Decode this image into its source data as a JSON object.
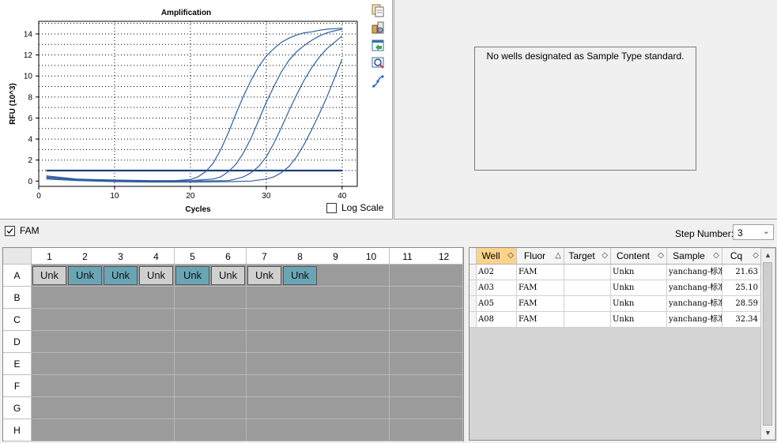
{
  "toolbar": {
    "icons": [
      "copy-icon",
      "chart-settings-icon",
      "export-icon",
      "zoom-icon",
      "curve-icon"
    ]
  },
  "chart_data": {
    "type": "line",
    "title": "Amplification",
    "xlabel": "Cycles",
    "ylabel": "RFU (10^3)",
    "xlim": [
      0,
      42
    ],
    "ylim": [
      -0.5,
      15.2
    ],
    "xticks": [
      0,
      10,
      20,
      30,
      40
    ],
    "yticks": [
      0,
      2,
      4,
      6,
      8,
      10,
      12,
      14
    ],
    "grid": true,
    "threshold": 1.0,
    "line_color": "#2f5fa0",
    "threshold_color": "#1f3f78",
    "series": [
      {
        "well": "A02",
        "cq": 21.63,
        "values": [
          [
            1,
            0.5
          ],
          [
            5,
            0.2
          ],
          [
            10,
            0.1
          ],
          [
            15,
            0.05
          ],
          [
            18,
            0.05
          ],
          [
            20,
            0.15
          ],
          [
            21,
            0.4
          ],
          [
            22,
            0.9
          ],
          [
            23,
            1.7
          ],
          [
            24,
            3.0
          ],
          [
            25,
            4.6
          ],
          [
            26,
            6.4
          ],
          [
            27,
            8.1
          ],
          [
            28,
            9.6
          ],
          [
            29,
            10.9
          ],
          [
            30,
            11.9
          ],
          [
            31,
            12.6
          ],
          [
            32,
            13.2
          ],
          [
            33,
            13.6
          ],
          [
            34,
            13.9
          ],
          [
            35,
            14.1
          ],
          [
            36,
            14.2
          ],
          [
            37,
            14.35
          ],
          [
            38,
            14.45
          ],
          [
            39,
            14.5
          ],
          [
            40,
            14.55
          ]
        ]
      },
      {
        "well": "A03",
        "cq": 25.1,
        "values": [
          [
            1,
            0.4
          ],
          [
            5,
            0.15
          ],
          [
            10,
            0.05
          ],
          [
            15,
            0.0
          ],
          [
            20,
            0.05
          ],
          [
            23,
            0.2
          ],
          [
            24,
            0.4
          ],
          [
            25,
            0.9
          ],
          [
            26,
            1.6
          ],
          [
            27,
            2.7
          ],
          [
            28,
            4.1
          ],
          [
            29,
            5.8
          ],
          [
            30,
            7.5
          ],
          [
            31,
            9.0
          ],
          [
            32,
            10.4
          ],
          [
            33,
            11.5
          ],
          [
            34,
            12.3
          ],
          [
            35,
            12.9
          ],
          [
            36,
            13.4
          ],
          [
            37,
            13.8
          ],
          [
            38,
            14.1
          ],
          [
            39,
            14.3
          ],
          [
            40,
            14.45
          ]
        ]
      },
      {
        "well": "A05",
        "cq": 28.59,
        "values": [
          [
            1,
            0.3
          ],
          [
            5,
            0.1
          ],
          [
            10,
            0.0
          ],
          [
            15,
            -0.05
          ],
          [
            20,
            0.0
          ],
          [
            25,
            0.05
          ],
          [
            26,
            0.2
          ],
          [
            27,
            0.4
          ],
          [
            28,
            0.8
          ],
          [
            29,
            1.4
          ],
          [
            30,
            2.3
          ],
          [
            31,
            3.6
          ],
          [
            32,
            5.1
          ],
          [
            33,
            6.7
          ],
          [
            34,
            8.2
          ],
          [
            35,
            9.6
          ],
          [
            36,
            10.8
          ],
          [
            37,
            11.8
          ],
          [
            38,
            12.6
          ],
          [
            39,
            13.2
          ],
          [
            40,
            13.8
          ]
        ]
      },
      {
        "well": "A08",
        "cq": 32.34,
        "values": [
          [
            1,
            0.2
          ],
          [
            5,
            0.05
          ],
          [
            10,
            -0.05
          ],
          [
            15,
            -0.1
          ],
          [
            20,
            -0.1
          ],
          [
            25,
            -0.05
          ],
          [
            28,
            0.0
          ],
          [
            30,
            0.2
          ],
          [
            31,
            0.4
          ],
          [
            32,
            0.8
          ],
          [
            33,
            1.4
          ],
          [
            34,
            2.3
          ],
          [
            35,
            3.5
          ],
          [
            36,
            4.9
          ],
          [
            37,
            6.4
          ],
          [
            38,
            8.0
          ],
          [
            39,
            9.8
          ],
          [
            40,
            11.6
          ]
        ]
      }
    ]
  },
  "axis": {
    "xticks": [
      "0",
      "10",
      "20",
      "30",
      "40"
    ],
    "yticks": [
      "0",
      "2",
      "4",
      "6",
      "8",
      "10",
      "12",
      "14"
    ]
  },
  "log_scale": {
    "label": "Log Scale",
    "checked": false
  },
  "std_curve": {
    "message": "No wells designated as Sample Type standard."
  },
  "fluor_toggle": {
    "label": "FAM",
    "checked": true
  },
  "step": {
    "label": "Step Number:",
    "value": "3"
  },
  "plate": {
    "columns": [
      "1",
      "2",
      "3",
      "4",
      "5",
      "6",
      "7",
      "8",
      "9",
      "10",
      "11",
      "12"
    ],
    "rows": [
      "A",
      "B",
      "C",
      "D",
      "E",
      "F",
      "G",
      "H"
    ],
    "wells": [
      {
        "row": "A",
        "col": 1,
        "label": "Unk",
        "selected": false
      },
      {
        "row": "A",
        "col": 2,
        "label": "Unk",
        "selected": true
      },
      {
        "row": "A",
        "col": 3,
        "label": "Unk",
        "selected": true
      },
      {
        "row": "A",
        "col": 4,
        "label": "Unk",
        "selected": false
      },
      {
        "row": "A",
        "col": 5,
        "label": "Unk",
        "selected": true
      },
      {
        "row": "A",
        "col": 6,
        "label": "Unk",
        "selected": false
      },
      {
        "row": "A",
        "col": 7,
        "label": "Unk",
        "selected": false
      },
      {
        "row": "A",
        "col": 8,
        "label": "Unk",
        "selected": true
      }
    ],
    "selected_color": "#6aa5b6",
    "unselected_color": "#cfcfcf",
    "empty_color": "#9b9b9b"
  },
  "results": {
    "columns": [
      {
        "label": "Well",
        "sort": "◇",
        "active": true
      },
      {
        "label": "Fluor",
        "sort": "△",
        "active": false
      },
      {
        "label": "Target",
        "sort": "◇",
        "active": false
      },
      {
        "label": "Content",
        "sort": "◇",
        "active": false
      },
      {
        "label": "Sample",
        "sort": "◇",
        "active": false
      },
      {
        "label": "Cq",
        "sort": "◇",
        "active": false
      }
    ],
    "rows": [
      [
        "A02",
        "FAM",
        "",
        "Unkn",
        "yanchang-标准",
        "21.63"
      ],
      [
        "A03",
        "FAM",
        "",
        "Unkn",
        "yanchang-标准",
        "25.10"
      ],
      [
        "A05",
        "FAM",
        "",
        "Unkn",
        "yanchang-标准",
        "28.59"
      ],
      [
        "A08",
        "FAM",
        "",
        "Unkn",
        "yanchang-标准",
        "32.34"
      ]
    ]
  }
}
